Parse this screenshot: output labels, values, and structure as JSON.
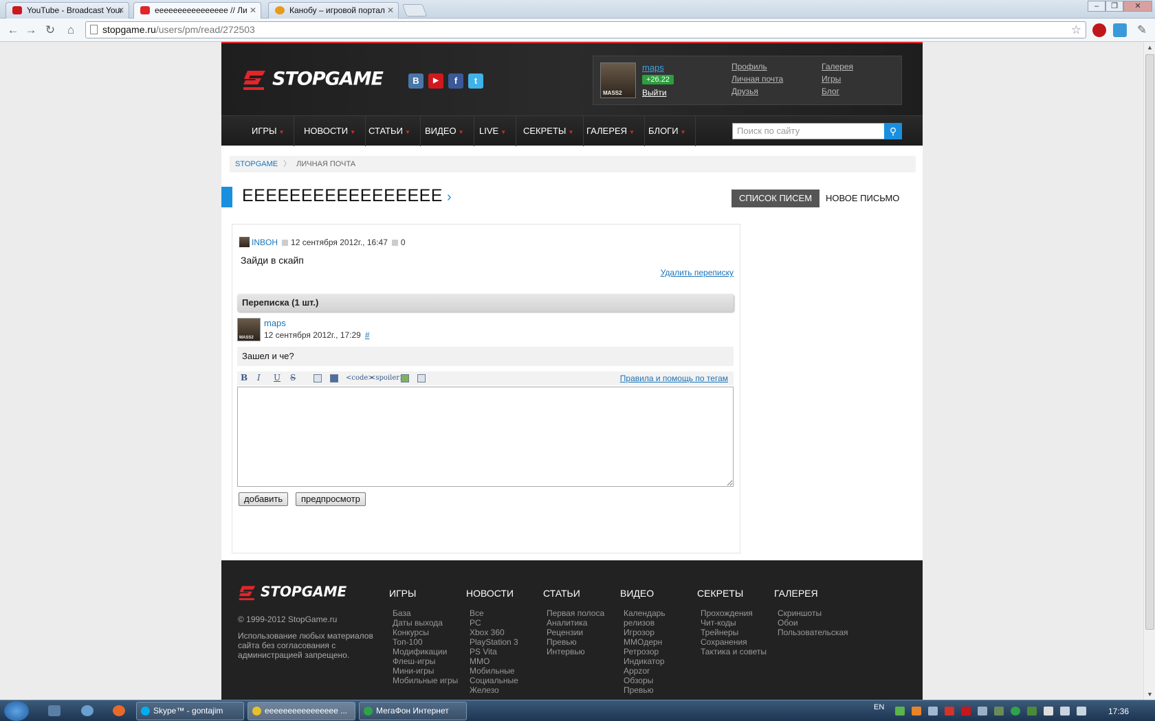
{
  "browser": {
    "tabs": [
      {
        "label": "YouTube - Broadcast Your",
        "color": "#cc181e"
      },
      {
        "label": "ееееееееееееееее // Ли",
        "color": "#e0262b"
      },
      {
        "label": "Канобу – игровой портал",
        "color": "#e89a1a"
      }
    ],
    "url_host": "stopgame.ru",
    "url_path": "/users/pm/read/272503"
  },
  "header": {
    "logo": "STOPGAME",
    "social": [
      "В",
      "▶",
      "f",
      "t"
    ],
    "user": {
      "name": "maps",
      "rating": "+26.22",
      "logout": "Выйти",
      "avatar_tag": "MASS2"
    },
    "links": [
      "Профиль",
      "Личная почта",
      "Друзья",
      "Галерея",
      "Игры",
      "Блог"
    ]
  },
  "nav": {
    "items": [
      "ИГРЫ",
      "НОВОСТИ",
      "СТАТЬИ",
      "ВИДЕО",
      "LIVE",
      "СЕКРЕТЫ",
      "ГАЛЕРЕЯ",
      "БЛОГИ"
    ],
    "search_placeholder": "Поиск по сайту"
  },
  "breadcrumb": {
    "home": "STOPGAME",
    "separator": "〉",
    "current": "ЛИЧНАЯ ПОЧТА"
  },
  "title": {
    "text": "ЕЕЕЕЕЕЕЕЕЕЕЕЕЕЕЕЕ",
    "arrow": "›"
  },
  "actions": {
    "list": "СПИСОК ПИСЕМ",
    "new": "НОВОЕ ПИСЬМО"
  },
  "message": {
    "author": "INBOH",
    "date": "12 сентября 2012г., 16:47",
    "comments": "0",
    "body": "Зайди в скайп",
    "delete": "Удалить переписку"
  },
  "thread": {
    "heading": "Переписка (1 шт.)",
    "reply": {
      "author": "maps",
      "date": "12 сентября 2012г., 17:29",
      "hash": "#",
      "body": "Зашел и че?"
    }
  },
  "editor": {
    "bold": "B",
    "italic": "I",
    "underline": "U",
    "strike": "S",
    "code": "<code>",
    "spoiler": "<spoiler>",
    "help": "Правила и помощь по тегам",
    "submit": "добавить",
    "preview": "предпросмотр"
  },
  "footer": {
    "logo": "STOPGAME",
    "copyright": "© 1999-2012 StopGame.ru",
    "note": "Использование любых материалов сайта без согласования с администрацией запрещено.",
    "columns": [
      {
        "head": "ИГРЫ",
        "links": [
          "База",
          "Даты выхода",
          "Конкурсы",
          "Топ-100",
          "Модификации",
          "Флеш-игры",
          "Мини-игры",
          "Мобильные игры"
        ]
      },
      {
        "head": "НОВОСТИ",
        "links": [
          "Все",
          "PC",
          "Xbox 360",
          "PlayStation 3",
          "PS Vita",
          "MMO",
          "Мобильные",
          "Социальные",
          "Железо"
        ]
      },
      {
        "head": "СТАТЬИ",
        "links": [
          "Первая полоса",
          "Аналитика",
          "Рецензии",
          "Превью",
          "Интервью"
        ]
      },
      {
        "head": "ВИДЕО",
        "links": [
          "Календарь релизов",
          "Игрозор",
          "MMOдерн",
          "Ретрозор",
          "Индикатор",
          "Appzor",
          "Обзоры",
          "Превью"
        ]
      },
      {
        "head": "СЕКРЕТЫ",
        "links": [
          "Прохождения",
          "Чит-коды",
          "Трейнеры",
          "Сохранения",
          "Тактика и советы"
        ]
      },
      {
        "head": "ГАЛЕРЕЯ",
        "links": [
          "Скриншоты",
          "Обои",
          "Пользовательская"
        ]
      }
    ]
  },
  "taskbar": {
    "items": [
      "Skype™ - gontajim",
      "ееееееееееееееее ...",
      "МегаФон Интернет"
    ],
    "lang": "EN",
    "clock": "17:36"
  }
}
